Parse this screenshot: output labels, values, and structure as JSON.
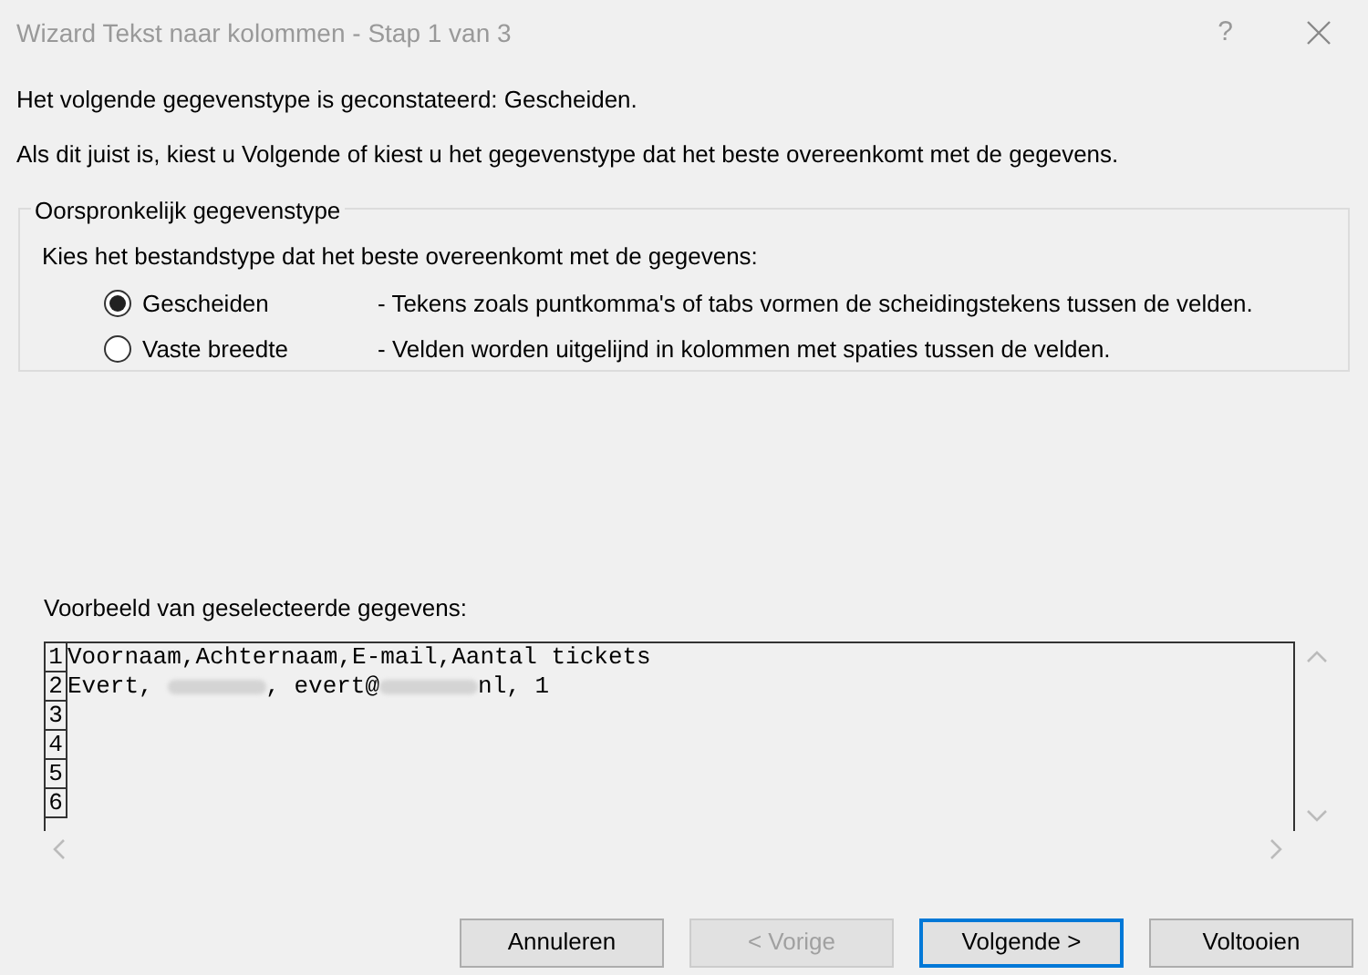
{
  "window": {
    "title": "Wizard Tekst naar kolommen - Stap 1 van 3",
    "help": "?"
  },
  "intro": [
    "Het volgende gegevenstype is geconstateerd: Gescheiden.",
    "Als dit juist is, kiest u Volgende of kiest u het gegevenstype dat het beste overeenkomt met de gegevens."
  ],
  "group": {
    "title": "Oorspronkelijk gegevenstype",
    "prompt": "Kies het bestandstype dat het beste overeenkomt met de gegevens:",
    "options": [
      {
        "label": "Gescheiden",
        "description": "- Tekens zoals puntkomma's of tabs vormen de scheidingstekens tussen de velden.",
        "selected": true
      },
      {
        "label": "Vaste breedte",
        "description": "- Velden worden uitgelijnd in kolommen met spaties tussen de velden.",
        "selected": false
      }
    ]
  },
  "preview": {
    "label": "Voorbeeld van geselecteerde gegevens:",
    "rows": [
      {
        "number": "1",
        "segments": [
          {
            "kind": "text",
            "text": "Voornaam,Achternaam,E-mail,Aantal tickets"
          }
        ]
      },
      {
        "number": "2",
        "segments": [
          {
            "kind": "text",
            "text": "Evert, "
          },
          {
            "kind": "redacted"
          },
          {
            "kind": "text",
            "text": ", evert@"
          },
          {
            "kind": "redacted"
          },
          {
            "kind": "text",
            "text": "nl, 1"
          }
        ]
      },
      {
        "number": "3",
        "segments": []
      },
      {
        "number": "4",
        "segments": []
      },
      {
        "number": "5",
        "segments": []
      },
      {
        "number": "6",
        "segments": []
      }
    ]
  },
  "buttons": [
    {
      "label": "Annuleren",
      "disabled": false,
      "default": false
    },
    {
      "label": "< Vorige",
      "disabled": true,
      "default": false
    },
    {
      "label": "Volgende >",
      "disabled": false,
      "default": true
    },
    {
      "label": "Voltooien",
      "disabled": false,
      "default": false
    }
  ]
}
